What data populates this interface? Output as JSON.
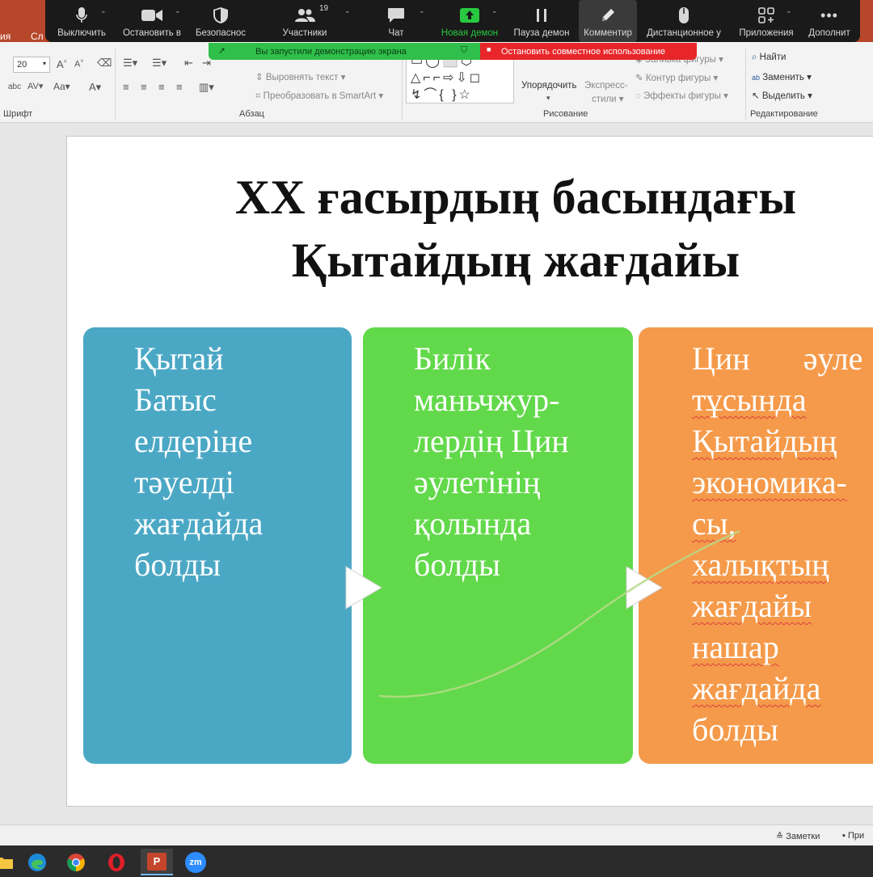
{
  "powerpoint": {
    "title_tabs": [
      "ия",
      "Сл"
    ],
    "ribbon": {
      "font_size": "20",
      "groups": {
        "font": "Шрифт",
        "paragraph": "Абзац",
        "drawing": "Рисование",
        "editing": "Редактирование"
      },
      "paragraph_items": [
        "Выровнять текст",
        "Преобразовать в SmartArt"
      ],
      "drawing_items": [
        "Упорядочить",
        "Экспресс-",
        "стили",
        "Заливка фигуры",
        "Контур фигуры",
        "Эффекты фигуры"
      ],
      "editing_items": [
        "Найти",
        "Заменить",
        "Выделить"
      ]
    }
  },
  "zoom_toolbar": {
    "items": [
      {
        "label": "Выключить",
        "icon": "microphone-icon"
      },
      {
        "label": "Остановить в",
        "icon": "video-camera-icon"
      },
      {
        "label": "Безопаснос",
        "icon": "shield-icon"
      },
      {
        "label": "Участники",
        "icon": "participants-icon",
        "badge": "19"
      },
      {
        "label": "Чат",
        "icon": "chat-icon"
      },
      {
        "label": "Новая демон",
        "icon": "share-screen-icon"
      },
      {
        "label": "Пауза демон",
        "icon": "pause-icon"
      },
      {
        "label": "Комментир",
        "icon": "pencil-icon"
      },
      {
        "label": "Дистанционное у",
        "icon": "mouse-icon"
      },
      {
        "label": "Приложения",
        "icon": "apps-icon"
      },
      {
        "label": "Дополнит",
        "icon": "more-icon"
      }
    ],
    "share_banner": "Вы запустили демонстрацию экрана",
    "stop_share": "Остановить совместное использование",
    "colors": {
      "accent_green": "#2fbf4a",
      "stop_red": "#e8262a"
    }
  },
  "slide": {
    "title_line1": "XX ғасырдың басындағы",
    "title_line2": "Қытайдың жағдайы",
    "boxes": [
      {
        "lines": [
          "Қытай",
          "Батыс",
          "елдеріне",
          "тәуелді",
          "жағдайда",
          "болды"
        ],
        "color": "#4ba8c5"
      },
      {
        "lines": [
          "Билік",
          "маньчжур-",
          "лердің Цин",
          "әулетінің",
          "қолында",
          "болды"
        ],
        "color": "#62d94a"
      },
      {
        "lines": [
          "Цин",
          "әуле",
          "тұсында",
          "Қытайдың",
          "экономика-",
          "сы,",
          "халықтың",
          "жағдайы",
          "нашар",
          "жағдайда",
          "болды"
        ],
        "color": "#f59a4a"
      }
    ]
  },
  "status_bar": {
    "notes": "Заметки",
    "comments": "При"
  },
  "taskbar": {
    "apps": [
      "file-explorer-icon",
      "edge-icon",
      "chrome-icon",
      "opera-icon",
      "powerpoint-icon",
      "zoom-icon"
    ],
    "powerpoint_label": "P",
    "zoom_label": "zm"
  }
}
